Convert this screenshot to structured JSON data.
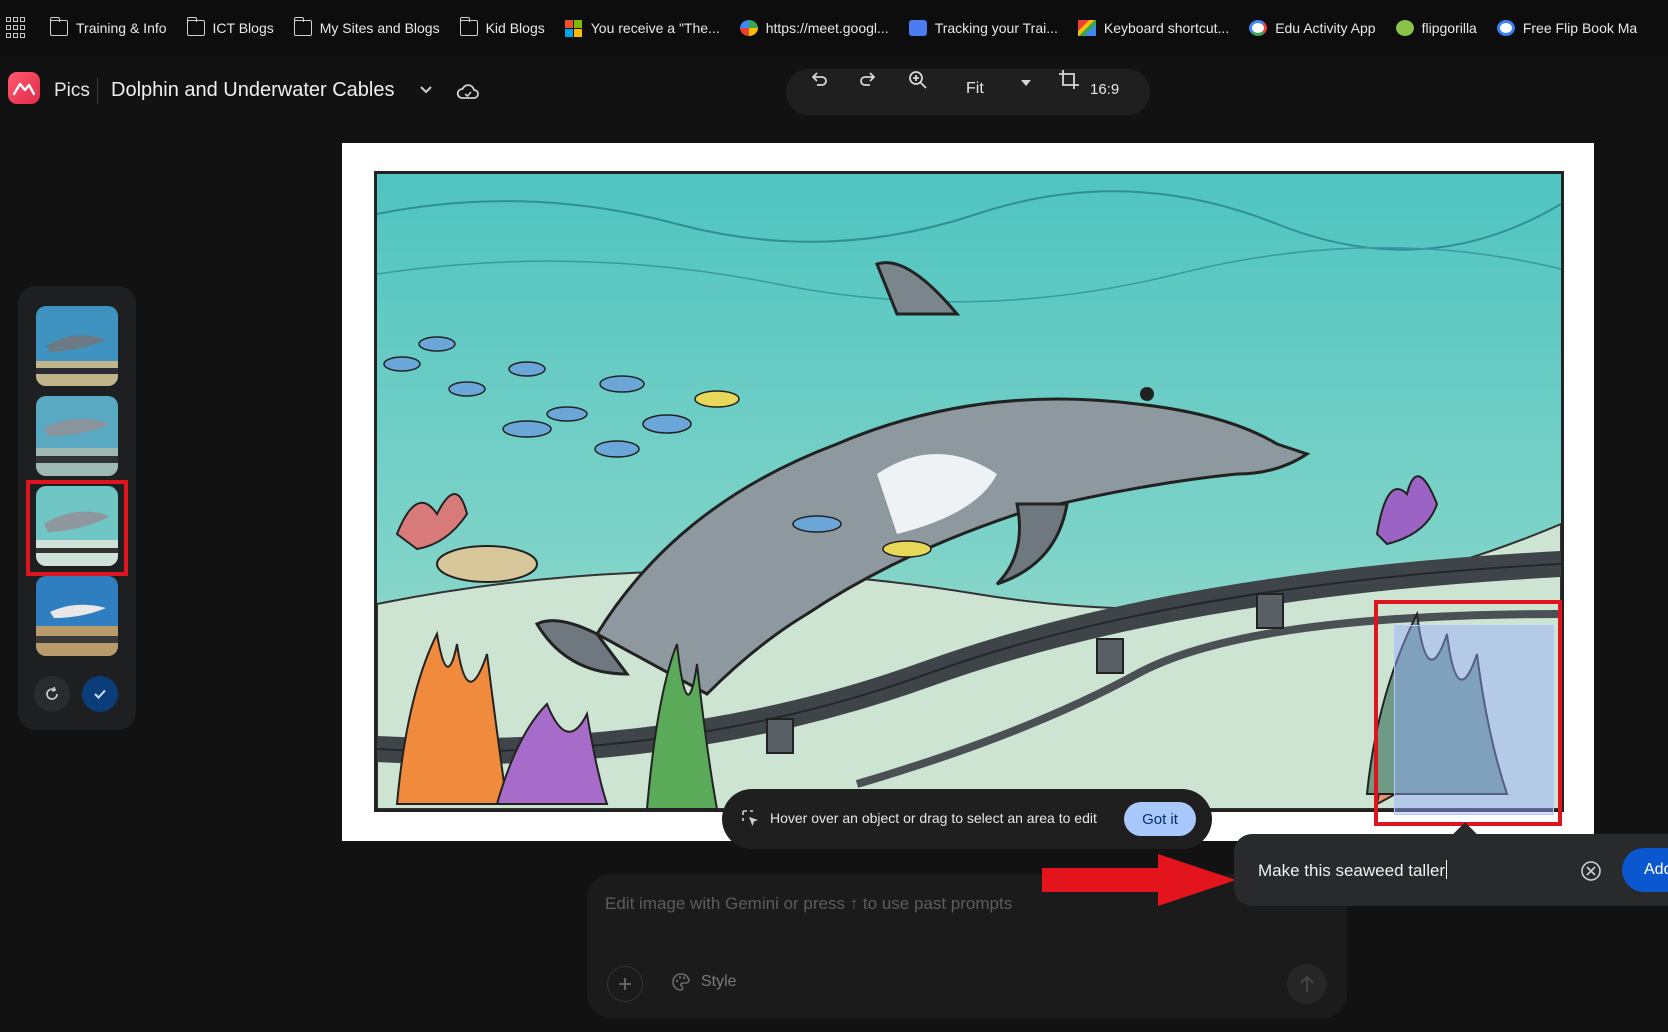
{
  "bookmarks": [
    {
      "label": "Training & Info",
      "icon": "folder-icon"
    },
    {
      "label": "ICT Blogs",
      "icon": "folder-icon"
    },
    {
      "label": "My Sites and Blogs",
      "icon": "folder-icon"
    },
    {
      "label": "Kid Blogs",
      "icon": "folder-icon"
    },
    {
      "label": "You receive a \"The...",
      "icon": "microsoft-icon"
    },
    {
      "label": "https://meet.googl...",
      "icon": "meet-icon"
    },
    {
      "label": "Tracking your Trai...",
      "icon": "chat-icon"
    },
    {
      "label": "Keyboard shortcut...",
      "icon": "gmail-icon"
    },
    {
      "label": "Edu Activity App",
      "icon": "google-icon"
    },
    {
      "label": "flipgorilla",
      "icon": "flipgorilla-icon"
    },
    {
      "label": "Free Flip Book Ma",
      "icon": "flipbook-icon"
    }
  ],
  "header": {
    "app_name": "Pics",
    "doc_title": "Dolphin and Underwater Cables"
  },
  "toolbar": {
    "zoom_label": "Fit",
    "aspect_label": "16:9"
  },
  "hint": {
    "text": "Hover over an object or drag to select an area to edit",
    "button": "Got it"
  },
  "prompt": {
    "placeholder": "Edit image with Gemini or press ↑ to use past prompts",
    "style_label": "Style"
  },
  "edit_popup": {
    "value": "Make this seaweed taller",
    "add_label": "Add"
  },
  "colors": {
    "accent": "#0b57d0",
    "highlight": "#e0141e",
    "chip": "#a8c7fa"
  }
}
